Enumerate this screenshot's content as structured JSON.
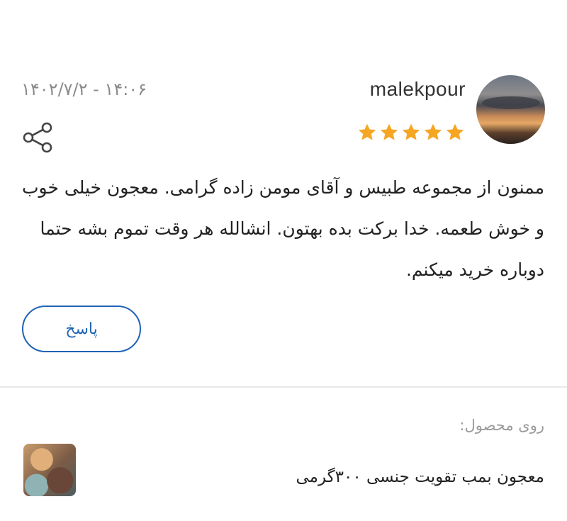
{
  "review": {
    "username": "malekpour",
    "date": "۱۴۰۲/۷/۲ - ۱۴:۰۶",
    "rating": 5,
    "comment": "ممنون از مجموعه طبیس و آقای مومن زاده گرامی. معجون خیلی خوب و خوش طعمه. خدا برکت بده بهتون. انشالله هر وقت تموم بشه حتما دوباره خرید میکنم.",
    "reply_label": "پاسخ"
  },
  "product": {
    "label": "روی محصول:",
    "name": "معجون بمب تقویت جنسی ۳۰۰گرمی"
  },
  "colors": {
    "star": "#f5a623",
    "accent": "#1f63b6",
    "muted": "#8a8a8a"
  },
  "icons": {
    "share": "share-icon",
    "star": "star-icon"
  }
}
